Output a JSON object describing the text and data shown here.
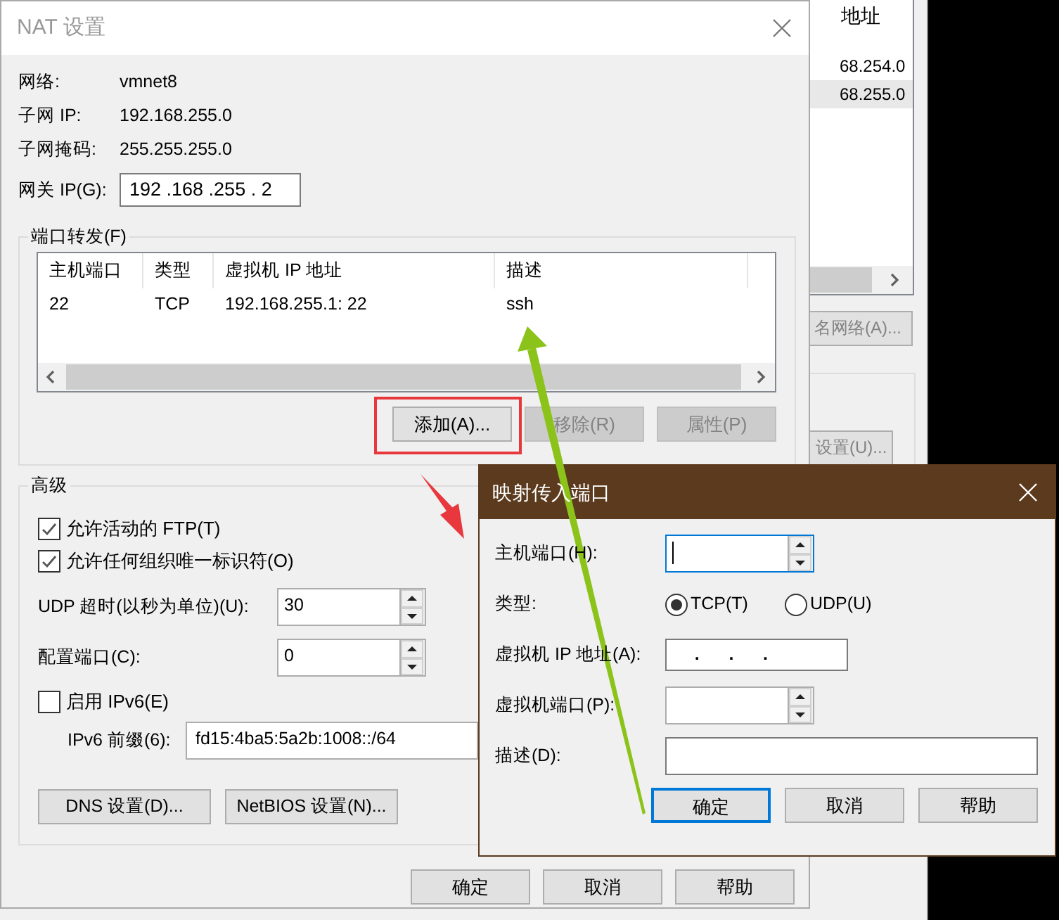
{
  "background_window": {
    "header": "地址",
    "rows": [
      {
        "text": "68.254.0",
        "selected": false
      },
      {
        "text": "68.255.0",
        "selected": true
      }
    ],
    "buttons": [
      "名网络(A)...",
      "设置(U)..."
    ]
  },
  "nat_dialog": {
    "title": "NAT 设置",
    "info": [
      {
        "label": "网络:",
        "value": "vmnet8"
      },
      {
        "label": "子网 IP:",
        "value": "192.168.255.0"
      },
      {
        "label": "子网掩码:",
        "value": "255.255.255.0"
      }
    ],
    "gateway": {
      "label": "网关 IP(G):",
      "value": "192 .168 .255 . 2"
    },
    "port_forwarding": {
      "title": "端口转发(F)",
      "columns": [
        "主机端口",
        "类型",
        "虚拟机 IP 地址",
        "描述"
      ],
      "rows": [
        [
          "22",
          "TCP",
          "192.168.255.1: 22",
          "ssh"
        ]
      ],
      "buttons": [
        {
          "label": "添加(A)...",
          "disabled": false
        },
        {
          "label": "移除(R)",
          "disabled": true
        },
        {
          "label": "属性(P)",
          "disabled": true
        }
      ]
    },
    "advanced": {
      "title": "高级",
      "options": [
        {
          "kind": "checkbox",
          "label": "允许活动的 FTP(T)",
          "checked": true
        },
        {
          "kind": "checkbox",
          "label": "允许任何组织唯一标识符(O)",
          "checked": true
        },
        {
          "kind": "spinner",
          "label": "UDP 超时(以秒为单位)(U):",
          "value": "30"
        },
        {
          "kind": "spinner",
          "label": "配置端口(C):",
          "value": "0"
        },
        {
          "kind": "checkbox",
          "label": "启用 IPv6(E)",
          "checked": false
        },
        {
          "kind": "text",
          "label": "IPv6 前缀(6):",
          "value": "fd15:4ba5:5a2b:1008::/64"
        }
      ],
      "buttons": [
        "DNS 设置(D)...",
        "NetBIOS 设置(N)..."
      ]
    },
    "buttons": [
      "确定",
      "取消",
      "帮助"
    ]
  },
  "map_dialog": {
    "title": "映射传入端口",
    "fields": [
      {
        "kind": "spinner",
        "label": "主机端口(H):",
        "focused": true
      },
      {
        "kind": "radio",
        "label": "类型:",
        "options": [
          {
            "label": "TCP(T)",
            "selected": true
          },
          {
            "label": "UDP(U)",
            "selected": false
          }
        ]
      },
      {
        "kind": "ip",
        "label": "虚拟机 IP 地址(A):",
        "value": "    .      .      ."
      },
      {
        "kind": "spinner",
        "label": "虚拟机端口(P):",
        "focused": false
      },
      {
        "kind": "text",
        "label": "描述(D):"
      }
    ],
    "buttons": [
      {
        "label": "确定",
        "default": true
      },
      {
        "label": "取消",
        "default": false
      },
      {
        "label": "帮助",
        "default": false
      }
    ]
  },
  "annotations": [
    {
      "kind": "box",
      "color": "#e8383d"
    },
    {
      "kind": "arrow",
      "color": "#e8383d"
    },
    {
      "kind": "arrow",
      "color": "#8cc31a"
    }
  ]
}
